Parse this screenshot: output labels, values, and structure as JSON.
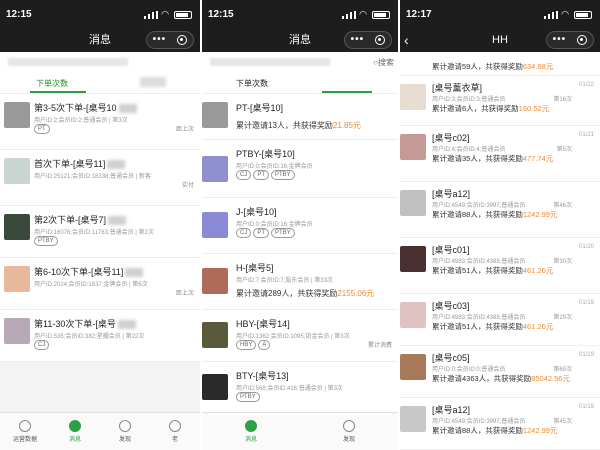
{
  "panels": [
    {
      "time": "12:15",
      "nav_title": "消息",
      "tab_label": "下单次数",
      "search_label": "",
      "cards": [
        {
          "title": "第3-5次下单-[桌号10",
          "sub": "用户ID:2;会员ID:2;普通会员 | 第3次",
          "tags": [
            "PT"
          ],
          "right": "距上次",
          "thumb": "#9a9a9a"
        },
        {
          "title": "首次下单-[桌号11]",
          "sub": "用户ID:25121;会员ID:18338;普通会员 | 新客",
          "tags": [],
          "right": "实付",
          "thumb": "#c8d6cf"
        },
        {
          "title": "第2次下单-[桌号7]",
          "sub": "用户ID:16076;会员ID:11763;普通会员 | 第2次",
          "tags": [
            "PTBY"
          ],
          "right": "",
          "thumb": "#3a4a3a"
        },
        {
          "title": "第6-10次下单-[桌号11]",
          "sub": "用户ID:2024;会员ID:1637;金牌会员 | 第6次",
          "tags": [],
          "right": "距上次",
          "thumb": "#e8b89a"
        },
        {
          "title": "第11-30次下单-[桌号",
          "sub": "用户ID:535;会员ID:382;星耀会员 | 第22次",
          "tags": [
            "CJ"
          ],
          "right": "",
          "thumb": "#b8a8b8"
        }
      ],
      "bottom": [
        "运营数据",
        "消息",
        "发现",
        "老"
      ]
    },
    {
      "time": "12:15",
      "nav_title": "消息",
      "tab_label": "下单次数",
      "search_label": "搜索",
      "cards": [
        {
          "title": "PT-[桌号10]",
          "invite": "累计邀请13人，共获得奖励",
          "reward": "21.85元",
          "thumb": "#9a9a9a"
        },
        {
          "title": "PTBY-[桌号10]",
          "sub": "用户ID:0;会员ID:16;金牌会员",
          "tags": [
            "CJ",
            "PT",
            "PTBY"
          ],
          "thumb": "#8f8fd0"
        },
        {
          "title": "J-[桌号10]",
          "sub": "用户ID:0;会员ID:16;金牌会员",
          "tags": [
            "CJ",
            "PT",
            "PTBY"
          ],
          "thumb": "#8a8ad6"
        },
        {
          "title": "H-[桌号5]",
          "sub": "用户ID:7;会员ID:7;股东会员 | 第33次",
          "invite": "累计邀请289人，共获得奖励",
          "reward": "2155.06元",
          "thumb": "#b06a5a"
        },
        {
          "title": "HBY-[桌号14]",
          "sub": "用户ID:1362;会员ID:1095;铂金会员 | 第3次",
          "tags": [
            "HBY",
            "A"
          ],
          "right": "累计消费",
          "thumb": "#5a5a3a"
        },
        {
          "title": "BTY-[桌号13]",
          "sub": "用户ID:568;会员ID:416;普通会员 | 第3次",
          "tags": [
            "PTBY"
          ],
          "thumb": "#2a2a2a"
        }
      ],
      "bottom": [
        "消息",
        "发现"
      ]
    },
    {
      "time": "12:17",
      "nav_title": "HH",
      "cards": [
        {
          "title": "",
          "sub": "",
          "invite": "累计邀请59人，共获得奖励",
          "reward": "634.68元",
          "date": "",
          "thumb": "#f2f2f2"
        },
        {
          "title": "[桌号薰衣草]",
          "sub": "用户ID:3;会员ID:3;普通会员",
          "cnt": "第16次",
          "invite": "累计邀请6人，共获得奖励",
          "reward": "160.52元",
          "date": "01/22",
          "thumb": "#e6dccf"
        },
        {
          "title": "[桌号c02]",
          "sub": "用户ID:4;会员ID:4;普通会员",
          "cnt": "第5次",
          "invite": "累计邀请35人，共获得奖励",
          "reward": "477.74元",
          "date": "01/21",
          "thumb": "#c59a96"
        },
        {
          "title": "[桌号a12]",
          "sub": "用户ID:4549;会员ID:3997;普通会员",
          "cnt": "第46次",
          "invite": "累计邀请88人，共获得奖励",
          "reward": "1242.99元",
          "date": "",
          "thumb": "#c0c0c0"
        },
        {
          "title": "[桌号c01]",
          "sub": "用户ID:4983;会员ID:4388;普通会员",
          "cnt": "第30次",
          "invite": "累计邀请51人，共获得奖励",
          "reward": "461.26元",
          "date": "01/20",
          "thumb": "#4a3030"
        },
        {
          "title": "[桌号c03]",
          "sub": "用户ID:4983;会员ID:4388;普通会员",
          "cnt": "第29次",
          "invite": "累计邀请51人，共获得奖励",
          "reward": "461.26元",
          "date": "01/19",
          "thumb": "#e0c2c2"
        },
        {
          "title": "[桌号c05]",
          "sub": "用户ID:0;会员ID:0;普通会员",
          "cnt": "第69次",
          "invite": "累计邀请4363人，共获得奖励",
          "reward": "85042.56元",
          "date": "01/19",
          "thumb": "#a87a5a"
        },
        {
          "title": "[桌号a12]",
          "sub": "用户ID:4549;会员ID:3997;普通会员",
          "cnt": "第45次",
          "invite": "累计邀请88人，共获得奖励",
          "reward": "1242.99元",
          "date": "01/19",
          "thumb": "#c8c8c8"
        }
      ]
    }
  ]
}
